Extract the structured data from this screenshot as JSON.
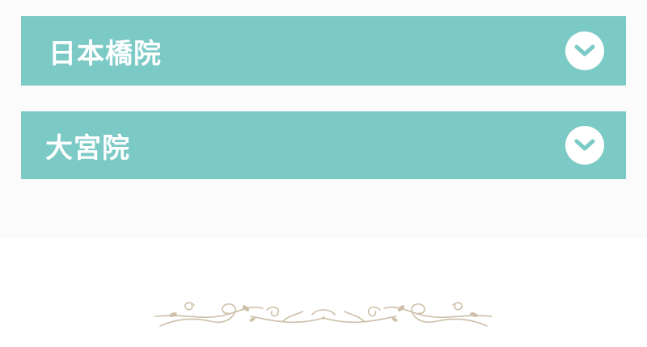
{
  "accordions": [
    {
      "label": "日本橋院",
      "icon": "chevron-down-icon"
    },
    {
      "label": "大宮院",
      "icon": "chevron-down-icon"
    }
  ],
  "colors": {
    "accordion_bg": "#7ccac6",
    "accordion_text": "#ffffff",
    "section_bg": "#fcfbfc",
    "ornament": "#cdbfa8"
  }
}
